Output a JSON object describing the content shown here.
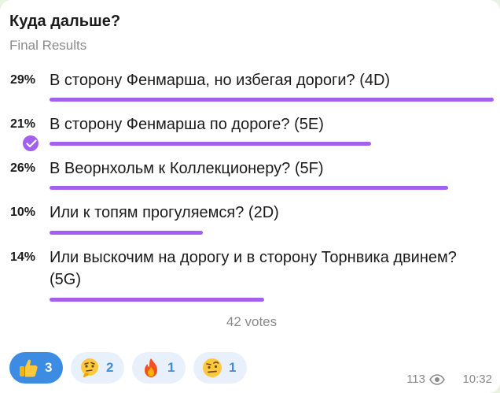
{
  "poll": {
    "question": "Куда дальше?",
    "type_label": "Final Results",
    "options": [
      {
        "percent_label": "29%",
        "percent": 29,
        "text": "В сторону Фенмарша, но избегая дороги? (4D)",
        "chosen": false
      },
      {
        "percent_label": "21%",
        "percent": 21,
        "text": "В сторону Фенмарша по дороге? (5E)",
        "chosen": true
      },
      {
        "percent_label": "26%",
        "percent": 26,
        "text": "В Веорнхольм к Коллекционеру? (5F)",
        "chosen": false
      },
      {
        "percent_label": "10%",
        "percent": 10,
        "text": "Или к топям прогуляемся? (2D)",
        "chosen": false
      },
      {
        "percent_label": "14%",
        "percent": 14,
        "text": "Или выскочим на дорогу и в сторону Торнвика двинем? (5G)",
        "chosen": false
      }
    ],
    "votes_label": "42 votes"
  },
  "reactions": [
    {
      "icon": "thumbs-up-icon",
      "count": "3",
      "selected": true
    },
    {
      "icon": "thinking-face-icon",
      "count": "2",
      "selected": false
    },
    {
      "icon": "fire-icon",
      "count": "1",
      "selected": false
    },
    {
      "icon": "raised-eyebrow-face-icon",
      "count": "1",
      "selected": false
    }
  ],
  "meta": {
    "views": "113",
    "time": "10:32"
  },
  "colors": {
    "bar": "#a35ff0",
    "reaction_selected": "#3d8ce4",
    "reaction_normal": "#e8f1fb"
  }
}
